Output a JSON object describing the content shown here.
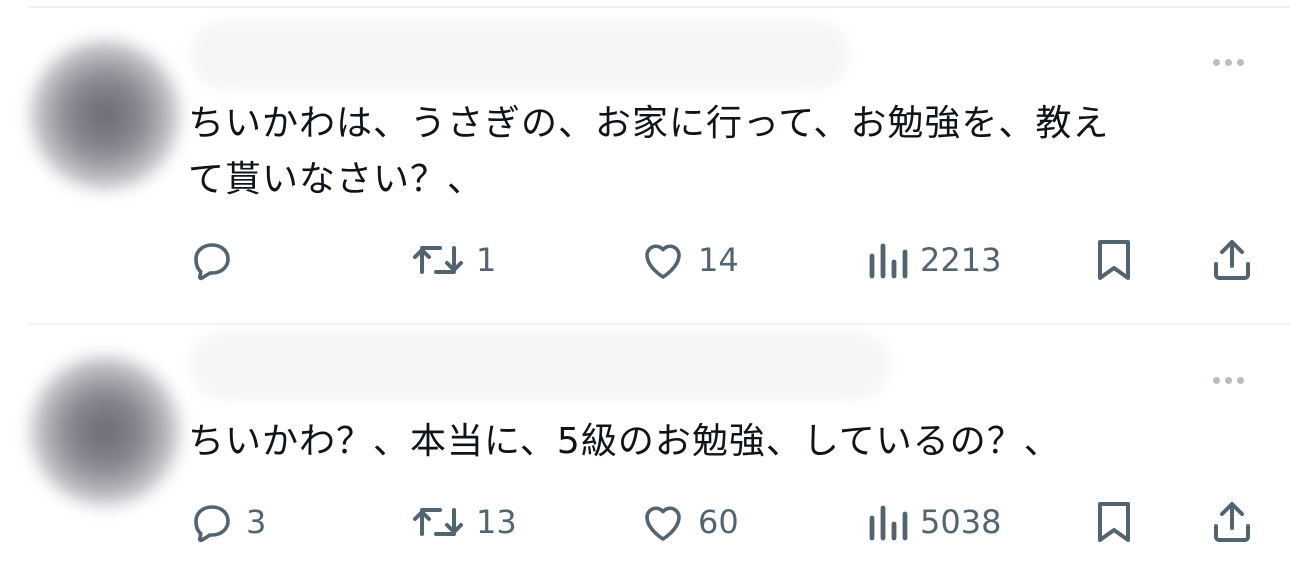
{
  "tweets": [
    {
      "text": "ちいかわは、うさぎの、お家に行って、お勉強を、教え\nて貰いなさい？、",
      "reply_count": "",
      "retweet_count": "1",
      "like_count": "14",
      "view_count": "2213",
      "icons": {
        "reply": "reply-icon",
        "retweet": "retweet-icon",
        "like": "heart-icon",
        "views": "views-chart-icon",
        "bookmark": "bookmark-icon",
        "share": "share-icon",
        "more": "more-dots-icon"
      }
    },
    {
      "text": "ちいかわ？、本当に、5級のお勉強、しているの？、",
      "reply_count": "3",
      "retweet_count": "13",
      "like_count": "60",
      "view_count": "5038",
      "icons": {
        "reply": "reply-icon",
        "retweet": "retweet-icon",
        "like": "heart-icon",
        "views": "views-chart-icon",
        "bookmark": "bookmark-icon",
        "share": "share-icon",
        "more": "more-dots-icon"
      }
    }
  ],
  "colors": {
    "text": "#0f1419",
    "action_gray": "#536471",
    "divider": "#eff3f4",
    "more_dots": "#b6bec5"
  }
}
